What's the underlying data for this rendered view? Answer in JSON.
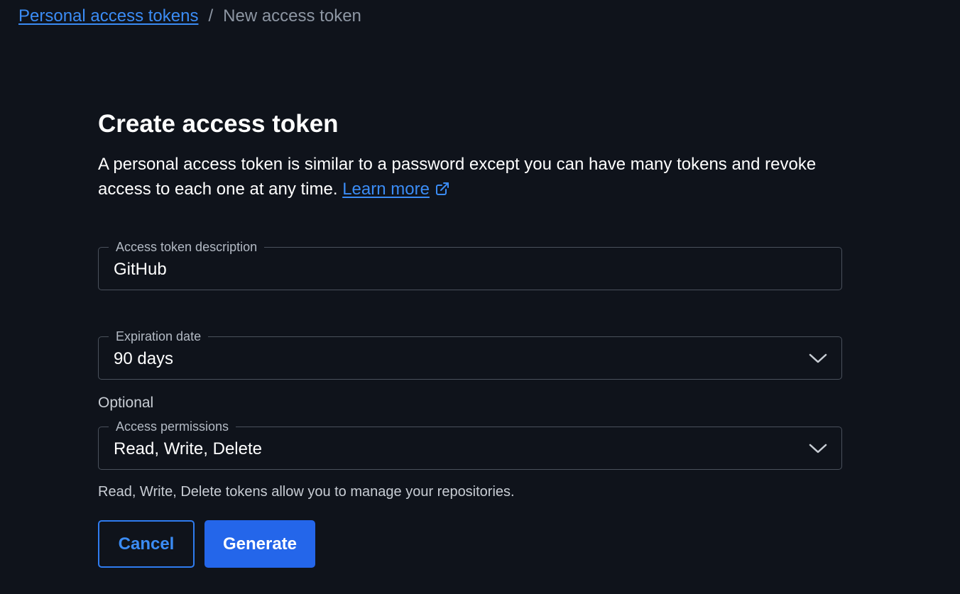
{
  "breadcrumb": {
    "parent": "Personal access tokens",
    "separator": "/",
    "current": "New access token"
  },
  "main": {
    "title": "Create access token",
    "intro_text": "A personal access token is similar to a password except you can have many tokens and revoke access to each one at any time.",
    "learn_more": "Learn more",
    "learn_more_icon": "external-link-icon"
  },
  "form": {
    "description": {
      "label": "Access token description",
      "value": "GitHub"
    },
    "expiration": {
      "label": "Expiration date",
      "value": "90 days",
      "icon": "chevron-down-icon"
    },
    "optional_label": "Optional",
    "permissions": {
      "label": "Access permissions",
      "value": "Read, Write, Delete",
      "icon": "chevron-down-icon",
      "helper": "Read, Write, Delete tokens allow you to manage your repositories."
    }
  },
  "actions": {
    "cancel": "Cancel",
    "generate": "Generate"
  },
  "colors": {
    "background": "#0f131b",
    "accent": "#3b8cf5",
    "primary_button": "#2466ea"
  }
}
